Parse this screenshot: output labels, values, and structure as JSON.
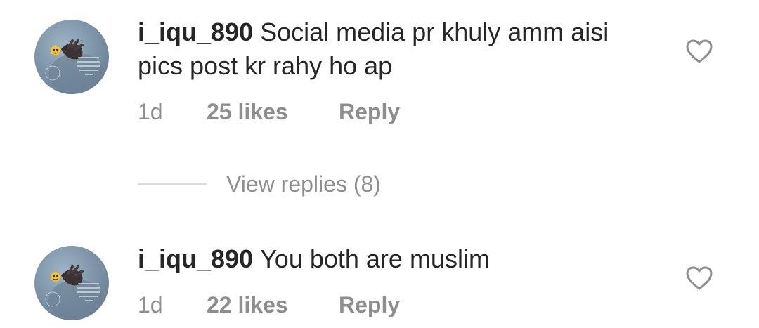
{
  "comments": [
    {
      "username": "i_iqu_890",
      "text": "Social media pr khuly amm aisi pics post kr rahy ho ap",
      "time": "1d",
      "likes": "25 likes",
      "reply_label": "Reply",
      "icon": "heart-outline-icon"
    },
    {
      "username": "i_iqu_890",
      "text": "You both are muslim",
      "time": "1d",
      "likes": "22 likes",
      "reply_label": "Reply",
      "icon": "heart-outline-icon"
    }
  ],
  "view_replies": {
    "label": "View replies (8)"
  },
  "colors": {
    "text": "#262626",
    "secondary": "#8e8e8e",
    "divider": "#dbdbdb"
  }
}
